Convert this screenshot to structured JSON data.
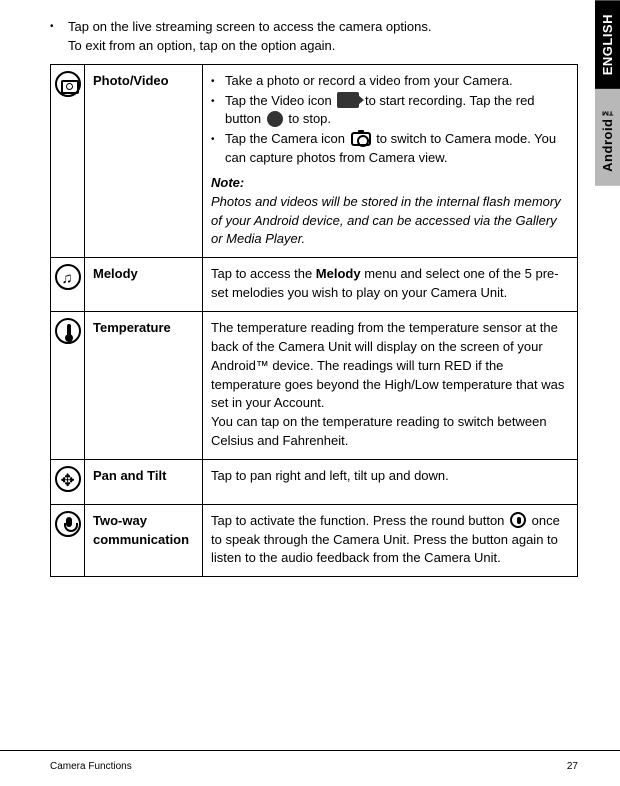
{
  "side_tabs": {
    "english": "ENGLISH",
    "android": "Android™"
  },
  "intro": {
    "line1": "Tap on the live streaming screen to access the camera options.",
    "line2": "To exit from an option, tap on the option again."
  },
  "photo_video": {
    "label": "Photo/Video",
    "b1": "Take a photo or record a video from your Camera.",
    "b2a": "Tap the Video icon ",
    "b2b": " to start recording. Tap the red button ",
    "b2c": " to stop.",
    "b3a": "Tap the Camera icon ",
    "b3b": " to switch to Camera mode. You can capture photos from Camera view.",
    "note_head": "Note:",
    "note_body": "Photos and videos will be stored in the internal flash memory of your Android device, and can be accessed via the Gallery or Media Player."
  },
  "melody": {
    "label": "Melody",
    "desc_a": "Tap to access the ",
    "desc_bold": "Melody",
    "desc_b": " menu and select one of the 5 pre-set melodies you wish to play on your Camera Unit."
  },
  "temperature": {
    "label": "Temperature",
    "p1": "The temperature reading from the temperature sensor at the back of the Camera Unit will display on the screen of your Android™ device. The readings will turn RED if the temperature goes beyond the High/Low temperature that was set in your Account.",
    "p2": "You can tap on the temperature reading to switch between Celsius and Fahrenheit."
  },
  "pan": {
    "label": "Pan and Tilt",
    "desc": "Tap to pan right and left, tilt up and down."
  },
  "twoway": {
    "label": "Two-way communication",
    "a": "Tap to activate the function. Press the round button ",
    "b": " once to speak through the Camera Unit. Press the button again to listen to the audio feedback from the Camera Unit."
  },
  "footer": {
    "left": "Camera Functions",
    "right": "27"
  }
}
